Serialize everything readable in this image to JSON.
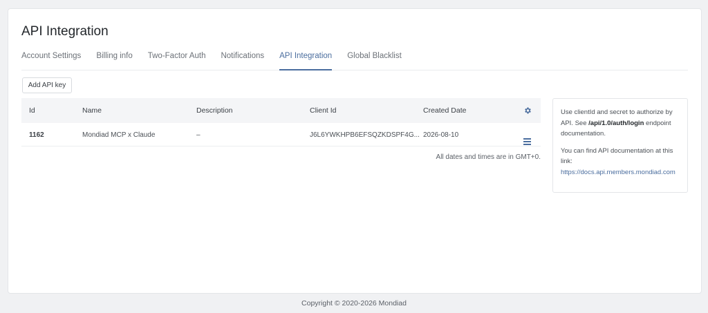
{
  "page": {
    "title": "API Integration"
  },
  "tabs": [
    {
      "label": "Account Settings"
    },
    {
      "label": "Billing info"
    },
    {
      "label": "Two-Factor Auth"
    },
    {
      "label": "Notifications"
    },
    {
      "label": "API Integration",
      "active": true
    },
    {
      "label": "Global Blacklist"
    }
  ],
  "toolbar": {
    "add_label": "Add API key"
  },
  "table": {
    "columns": [
      "Id",
      "Name",
      "Description",
      "Client Id",
      "Created Date"
    ],
    "settings_icon": "gear-icon",
    "rows": [
      {
        "id": "1162",
        "name": "Mondiad MCP x Claude",
        "description": "–",
        "client_id": "J6L6YWKHPB6EFSQZKDSPF4G...",
        "created": "2026-08-10",
        "action_icon": "hamburger-menu-icon"
      }
    ],
    "timezone_note": "All dates and times are in GMT+0."
  },
  "info": {
    "p1_a": "Use clientId and secret to authorize by API. See ",
    "p1_code": "/api/1.0/auth/login",
    "p1_b": " endpoint documentation.",
    "p2": "You can find API documentation at this link:",
    "link": "https://docs.api.members.mondiad.com"
  },
  "footer": {
    "copyright": "Copyright © 2020-2026 Mondiad"
  },
  "colors": {
    "accent": "#4a6d9e",
    "background": "#f0f1f3",
    "header_row": "#f4f5f7"
  }
}
